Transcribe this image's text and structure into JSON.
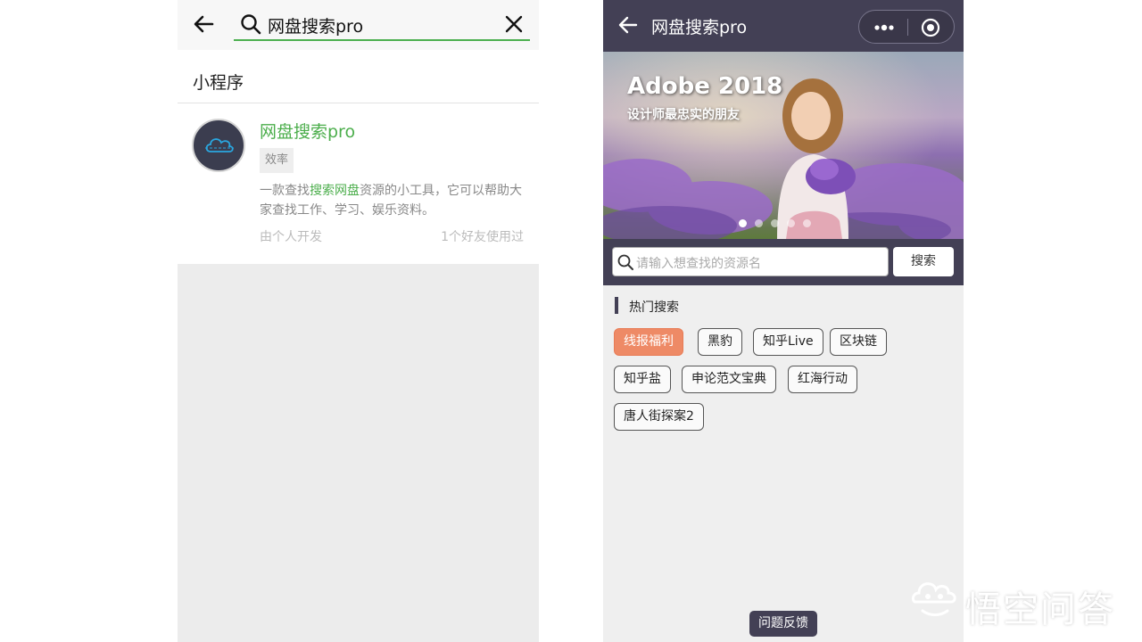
{
  "left": {
    "search_query": "网盘搜索pro",
    "section_title": "小程序",
    "result": {
      "name": "网盘搜索pro",
      "tag": "效率",
      "desc_1": "一款查找",
      "desc_hl": "搜索网盘",
      "desc_2": "资源的小工具，它可以帮助大家查找工作、学习、娱乐资料。",
      "developer": "由个人开发",
      "friends_used": "1个好友使用过"
    },
    "accent": "#4cae4c"
  },
  "right": {
    "title": "网盘搜索pro",
    "banner": {
      "title": "Adobe 2018",
      "subtitle": "设计师最忠实的朋友",
      "dot_count": 5,
      "active_dot": 0
    },
    "search": {
      "placeholder": "请输入想查找的资源名",
      "button_label": "搜索"
    },
    "hot": {
      "title": "热门搜索",
      "tags": [
        "线报福利",
        "黑豹",
        "知乎Live",
        "区块链",
        "知乎盐",
        "申论范文宝典",
        "红海行动",
        "唐人街探案2"
      ],
      "active_tag_index": 0
    },
    "feedback_label": "问题反馈",
    "header_color": "#434055",
    "active_tag_color": "#ee8a66"
  },
  "watermark": {
    "text": "悟空问答"
  }
}
